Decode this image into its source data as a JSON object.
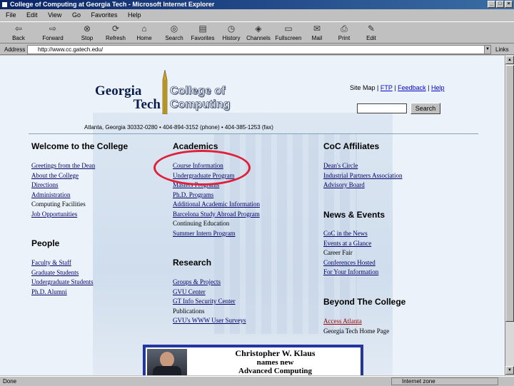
{
  "window": {
    "title": "College of Computing at Georgia Tech - Microsoft Internet Explorer"
  },
  "menu": [
    "File",
    "Edit",
    "View",
    "Go",
    "Favorites",
    "Help"
  ],
  "toolbar": {
    "items": [
      {
        "label": "Back",
        "icon": "back-arrow-icon"
      },
      {
        "label": "Forward",
        "icon": "forward-arrow-icon"
      },
      {
        "label": "Stop",
        "icon": "stop-icon"
      },
      {
        "label": "Refresh",
        "icon": "refresh-icon"
      },
      {
        "label": "Home",
        "icon": "home-icon"
      },
      {
        "label": "Search",
        "icon": "search-icon"
      },
      {
        "label": "Favorites",
        "icon": "favorites-icon"
      },
      {
        "label": "History",
        "icon": "history-icon"
      },
      {
        "label": "Channels",
        "icon": "channels-icon"
      },
      {
        "label": "Fullscreen",
        "icon": "fullscreen-icon"
      },
      {
        "label": "Mail",
        "icon": "mail-icon"
      },
      {
        "label": "Print",
        "icon": "print-icon"
      },
      {
        "label": "Edit",
        "icon": "edit-icon"
      }
    ]
  },
  "address": {
    "label": "Address",
    "value": "http://www.cc.gatech.edu/",
    "links_label": "Links"
  },
  "page": {
    "logo_line1": "Georgia",
    "logo_line2": "Tech",
    "coc_line1": "College of",
    "coc_line2": "Computing",
    "top_links": {
      "site_map": "Site Map",
      "sep1": "|",
      "ftp": "FTP",
      "sep2": "|",
      "feedback": "Feedback",
      "sep3": "|",
      "help": "Help"
    },
    "search_button": "Search",
    "contact": "Atlanta, Georgia 30332-0280 • 404-894-3152 (phone) • 404-385-1253 (fax)",
    "sections": {
      "welcome": {
        "heading": "Welcome to the College",
        "links": [
          "Greetings from the Dean",
          "About the College",
          "Directions",
          "Administration",
          "Computing Facilities",
          "Job Opportunities"
        ]
      },
      "people": {
        "heading": "People",
        "links": [
          "Faculty & Staff",
          "Graduate Students",
          "Undergraduate Students",
          "Ph.D. Alumni"
        ]
      },
      "academics": {
        "heading": "Academics",
        "links": [
          "Course Information",
          "Undergraduate Program",
          "Masters Programs",
          "Ph.D. Programs",
          "Additional Academic Information",
          "Barcelona Study Abroad Program",
          "Continuing Education",
          "Summer Intern Program"
        ]
      },
      "research": {
        "heading": "Research",
        "links": [
          "Groups & Projects",
          "GVU Center",
          "GT Info Security Center",
          "Publications",
          "GVU's WWW User Surveys"
        ]
      },
      "affiliates": {
        "heading": "CoC Affiliates",
        "links": [
          "Dean's Circle",
          "Industrial Partners Association",
          "Advisory Board"
        ]
      },
      "news": {
        "heading": "News & Events",
        "links": [
          "CoC in the News",
          "Events at a Glance",
          "Career Fair",
          "Conferences Hosted",
          "For Your Information"
        ]
      },
      "beyond": {
        "heading": "Beyond The College",
        "links": [
          "Access Atlanta",
          "Georgia Tech Home Page"
        ]
      }
    },
    "banner": {
      "line1": "Christopher W. Klaus",
      "line2": "names new",
      "line3": "Advanced Computing"
    }
  },
  "status": {
    "left": "Done",
    "zone": "Internet zone"
  },
  "colors": {
    "titlebar": "#0a246a",
    "link": "#000066",
    "highlight_circle": "#e0203a",
    "page_bg": "#ebf2fa"
  }
}
